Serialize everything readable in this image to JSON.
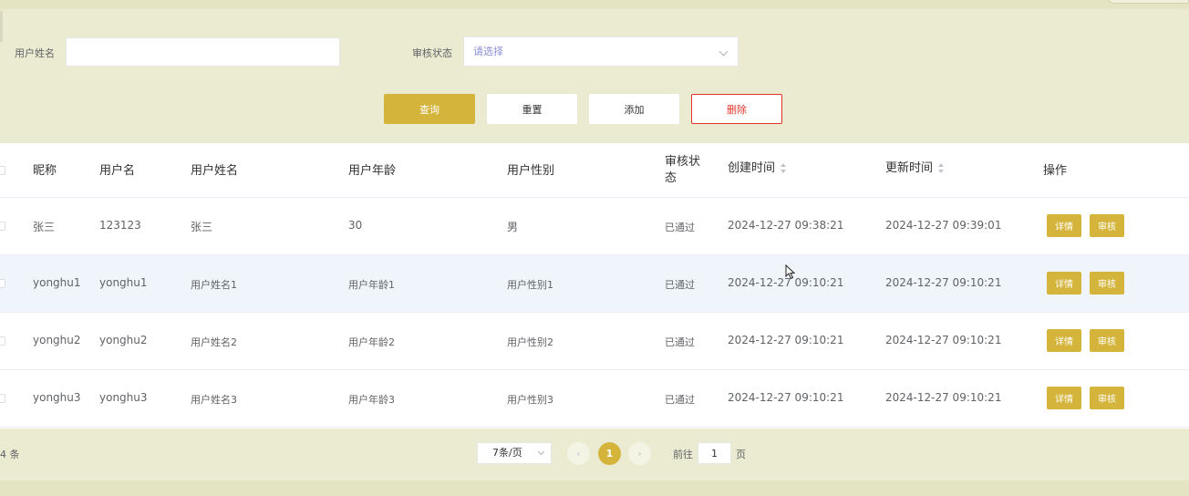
{
  "search": {
    "name_label": "用户姓名",
    "name_value": "",
    "status_label": "审核状态",
    "status_placeholder": "请选择"
  },
  "actions": {
    "query": "查询",
    "reset": "重置",
    "add": "添加",
    "delete": "删除"
  },
  "table": {
    "headers": {
      "nickname": "昵称",
      "username": "用户名",
      "real_name": "用户姓名",
      "age": "用户年龄",
      "gender": "用户性别",
      "status_line1": "审核状",
      "status_line2": "态",
      "created": "创建时间",
      "updated": "更新时间",
      "ops": "操作"
    },
    "rows": [
      {
        "nickname": "张三",
        "username": "123123",
        "real_name": "张三",
        "age": "30",
        "gender": "男",
        "status": "已通过",
        "created": "2024-12-27 09:38:21",
        "updated": "2024-12-27 09:39:01"
      },
      {
        "nickname": "yonghu1",
        "username": "yonghu1",
        "real_name": "用户姓名1",
        "age": "用户年龄1",
        "gender": "用户性别1",
        "status": "已通过",
        "created": "2024-12-27 09:10:21",
        "updated": "2024-12-27 09:10:21"
      },
      {
        "nickname": "yonghu2",
        "username": "yonghu2",
        "real_name": "用户姓名2",
        "age": "用户年龄2",
        "gender": "用户性别2",
        "status": "已通过",
        "created": "2024-12-27 09:10:21",
        "updated": "2024-12-27 09:10:21"
      },
      {
        "nickname": "yonghu3",
        "username": "yonghu3",
        "real_name": "用户姓名3",
        "age": "用户年龄3",
        "gender": "用户性别3",
        "status": "已通过",
        "created": "2024-12-27 09:10:21",
        "updated": "2024-12-27 09:10:21"
      }
    ],
    "row_actions": {
      "detail": "详情",
      "review": "审核"
    }
  },
  "pagination": {
    "total": "4 条",
    "page_size": "7条/页",
    "prev_icon": "chevron-left-icon",
    "next_icon": "chevron-right-icon",
    "prev": "‹",
    "next": "›",
    "current_page": "1",
    "goto_prefix": "前往",
    "goto_value": "1",
    "goto_suffix": "页"
  },
  "colors": {
    "accent": "#d4b43a",
    "background": "#ebebd1",
    "danger": "#e4342a",
    "row_highlight": "#f0f5fc"
  }
}
